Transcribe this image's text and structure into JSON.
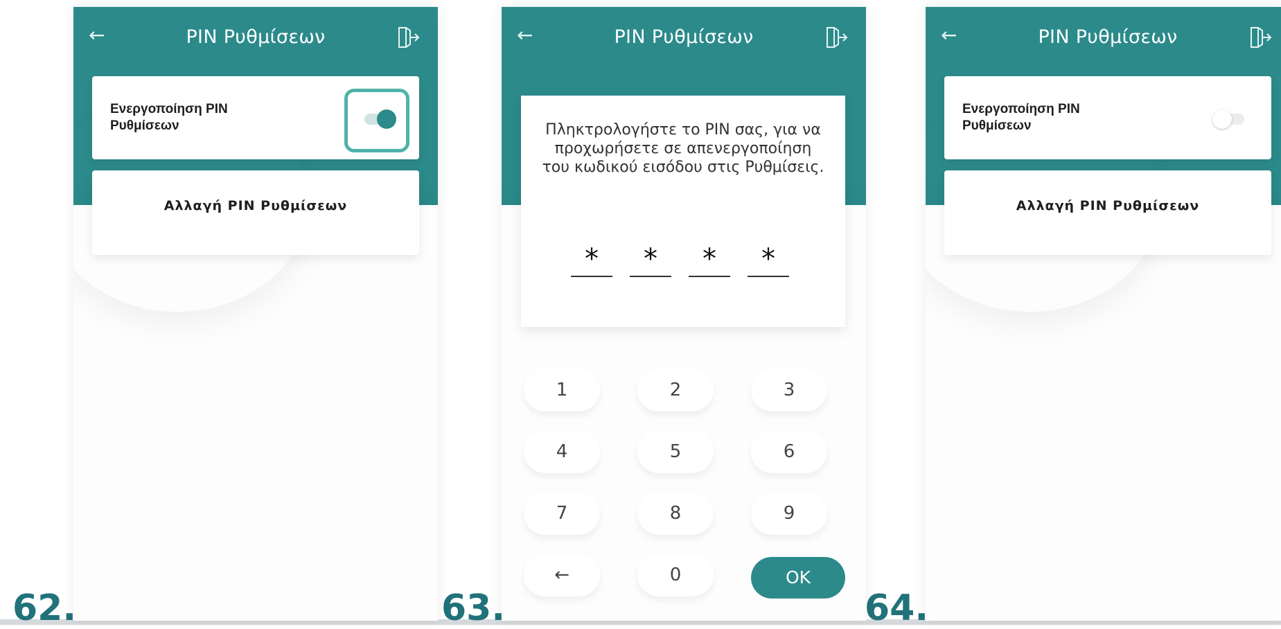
{
  "colors": {
    "teal": "#2c8a8b",
    "step_number": "#21727a",
    "highlight": "#4fb3a9"
  },
  "steps": [
    {
      "number": "62."
    },
    {
      "number": "63."
    },
    {
      "number": "64."
    }
  ],
  "screen1": {
    "title": "PIN Ρυθμίσεων",
    "back_icon": "arrow-left-icon",
    "logout_icon": "logout-icon",
    "toggle_label": "Ενεργοποίηση PIN Ρυθμίσεων",
    "toggle_state": "on",
    "change_label": "Αλλαγή PIN Ρυθμίσεων"
  },
  "screen2": {
    "title": "PIN Ρυθμίσεων",
    "message": "Πληκτρολογήστε το PIN σας, για να προχωρήσετε σε απενεργοποίηση του κωδικού εισόδου στις Ρυθμίσεις.",
    "digits": [
      "*",
      "*",
      "*",
      "*"
    ],
    "keys": [
      "1",
      "2",
      "3",
      "4",
      "5",
      "6",
      "7",
      "8",
      "9",
      "←",
      "0",
      "OK"
    ]
  },
  "screen3": {
    "title": "PIN Ρυθμίσεων",
    "toggle_label": "Ενεργοποίηση PIN Ρυθμίσεων",
    "toggle_state": "off",
    "change_label": "Αλλαγή PIN Ρυθμίσεων"
  }
}
